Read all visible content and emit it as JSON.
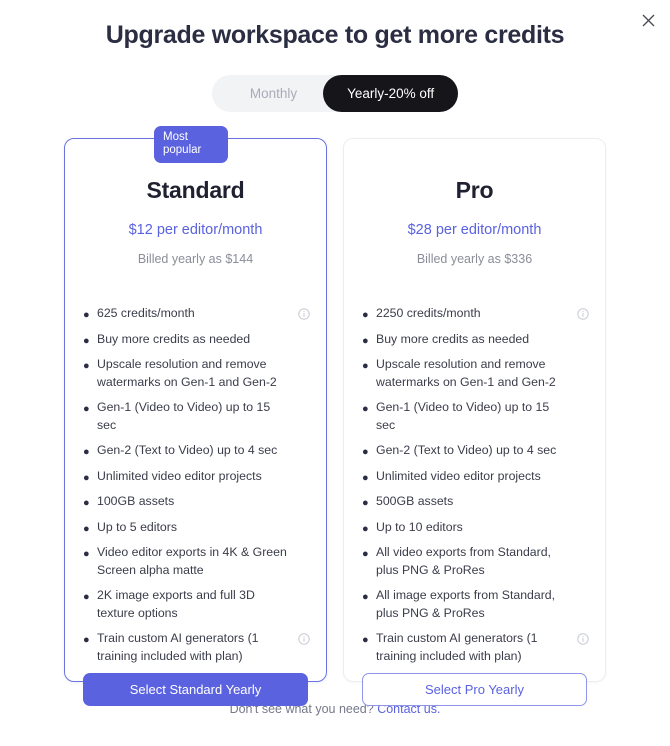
{
  "modal": {
    "title": "Upgrade workspace to get more credits",
    "close_icon": "close-icon"
  },
  "billing_toggle": {
    "monthly_label": "Monthly",
    "yearly_label": "Yearly-20% off",
    "selected": "Yearly-20% off"
  },
  "colors": {
    "accent": "#5a62e0",
    "badge": "#5a62e0",
    "toggle_active_bg": "#16161a",
    "toggle_bg": "#f2f3f5",
    "title": "#2b2d42",
    "muted": "#8b8e99"
  },
  "plans": [
    {
      "badge": "Most popular",
      "name": "Standard",
      "price": "$12 per editor/month",
      "billed": "Billed yearly as $144",
      "features": [
        {
          "text": "625 credits/month",
          "info": true
        },
        {
          "text": "Buy more credits as needed",
          "info": false
        },
        {
          "text": "Upscale resolution and remove watermarks on Gen-1 and Gen-2",
          "info": false
        },
        {
          "text": "Gen-1 (Video to Video) up to 15 sec",
          "info": false
        },
        {
          "text": "Gen-2 (Text to Video) up to 4 sec",
          "info": false
        },
        {
          "text": "Unlimited video editor projects",
          "info": false
        },
        {
          "text": "100GB assets",
          "info": false
        },
        {
          "text": "Up to 5 editors",
          "info": false
        },
        {
          "text": "Video editor exports in 4K & Green Screen alpha matte",
          "info": false
        },
        {
          "text": "2K image exports and full 3D texture options",
          "info": false
        },
        {
          "text": "Train custom AI generators (1 training included with plan)",
          "info": true
        }
      ],
      "cta": "Select Standard Yearly",
      "cta_style": "filled"
    },
    {
      "badge": "",
      "name": "Pro",
      "price": "$28 per editor/month",
      "billed": "Billed yearly as $336",
      "features": [
        {
          "text": "2250 credits/month",
          "info": true
        },
        {
          "text": "Buy more credits as needed",
          "info": false
        },
        {
          "text": "Upscale resolution and remove watermarks on Gen-1 and Gen-2",
          "info": false
        },
        {
          "text": "Gen-1 (Video to Video) up to 15 sec",
          "info": false
        },
        {
          "text": "Gen-2 (Text to Video) up to 4 sec",
          "info": false
        },
        {
          "text": "Unlimited video editor projects",
          "info": false
        },
        {
          "text": "500GB assets",
          "info": false
        },
        {
          "text": "Up to 10 editors",
          "info": false
        },
        {
          "text": "All video exports from Standard, plus PNG & ProRes",
          "info": false
        },
        {
          "text": "All image exports from Standard, plus PNG & ProRes",
          "info": false
        },
        {
          "text": "Train custom AI generators (1 training included with plan)",
          "info": true
        }
      ],
      "cta": "Select Pro Yearly",
      "cta_style": "outline"
    }
  ],
  "footer": {
    "text": "Don't see what you need?",
    "link": "Contact us."
  }
}
